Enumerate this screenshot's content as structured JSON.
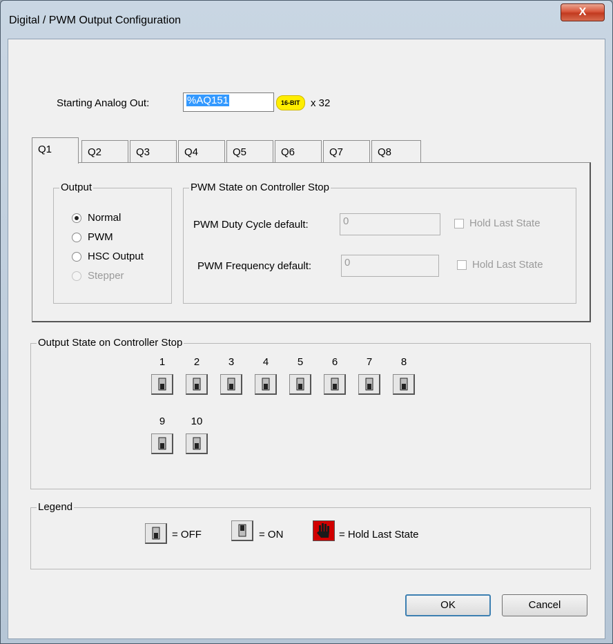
{
  "window": {
    "title": "Digital / PWM Output Configuration",
    "close_label": "X"
  },
  "analog": {
    "label": "Starting Analog Out:",
    "value": "%AQ151",
    "badge": "16-BIT",
    "multiplier": "x 32"
  },
  "tabs": [
    "Q1",
    "Q2",
    "Q3",
    "Q4",
    "Q5",
    "Q6",
    "Q7",
    "Q8"
  ],
  "output_group": {
    "title": "Output",
    "options": [
      {
        "label": "Normal",
        "selected": true,
        "enabled": true
      },
      {
        "label": "PWM",
        "selected": false,
        "enabled": true
      },
      {
        "label": "HSC Output",
        "selected": false,
        "enabled": true
      },
      {
        "label": "Stepper",
        "selected": false,
        "enabled": false
      }
    ]
  },
  "pwm_group": {
    "title": "PWM State on Controller Stop",
    "duty_label": "PWM Duty Cycle default:",
    "duty_value": "0",
    "freq_label": "PWM Frequency default:",
    "freq_value": "0",
    "hold_label_1": "Hold Last State",
    "hold_label_2": "Hold Last State"
  },
  "stop_group": {
    "title": "Output State on Controller Stop",
    "outputs": [
      "1",
      "2",
      "3",
      "4",
      "5",
      "6",
      "7",
      "8",
      "9",
      "10"
    ]
  },
  "legend": {
    "title": "Legend",
    "off_label": "= OFF",
    "on_label": "= ON",
    "hold_label": "= Hold Last State"
  },
  "buttons": {
    "ok": "OK",
    "cancel": "Cancel"
  },
  "colors": {
    "selection": "#3399ff",
    "badge": "#ffee00",
    "close": "#c23a1f",
    "hold_icon": "#d10000"
  }
}
